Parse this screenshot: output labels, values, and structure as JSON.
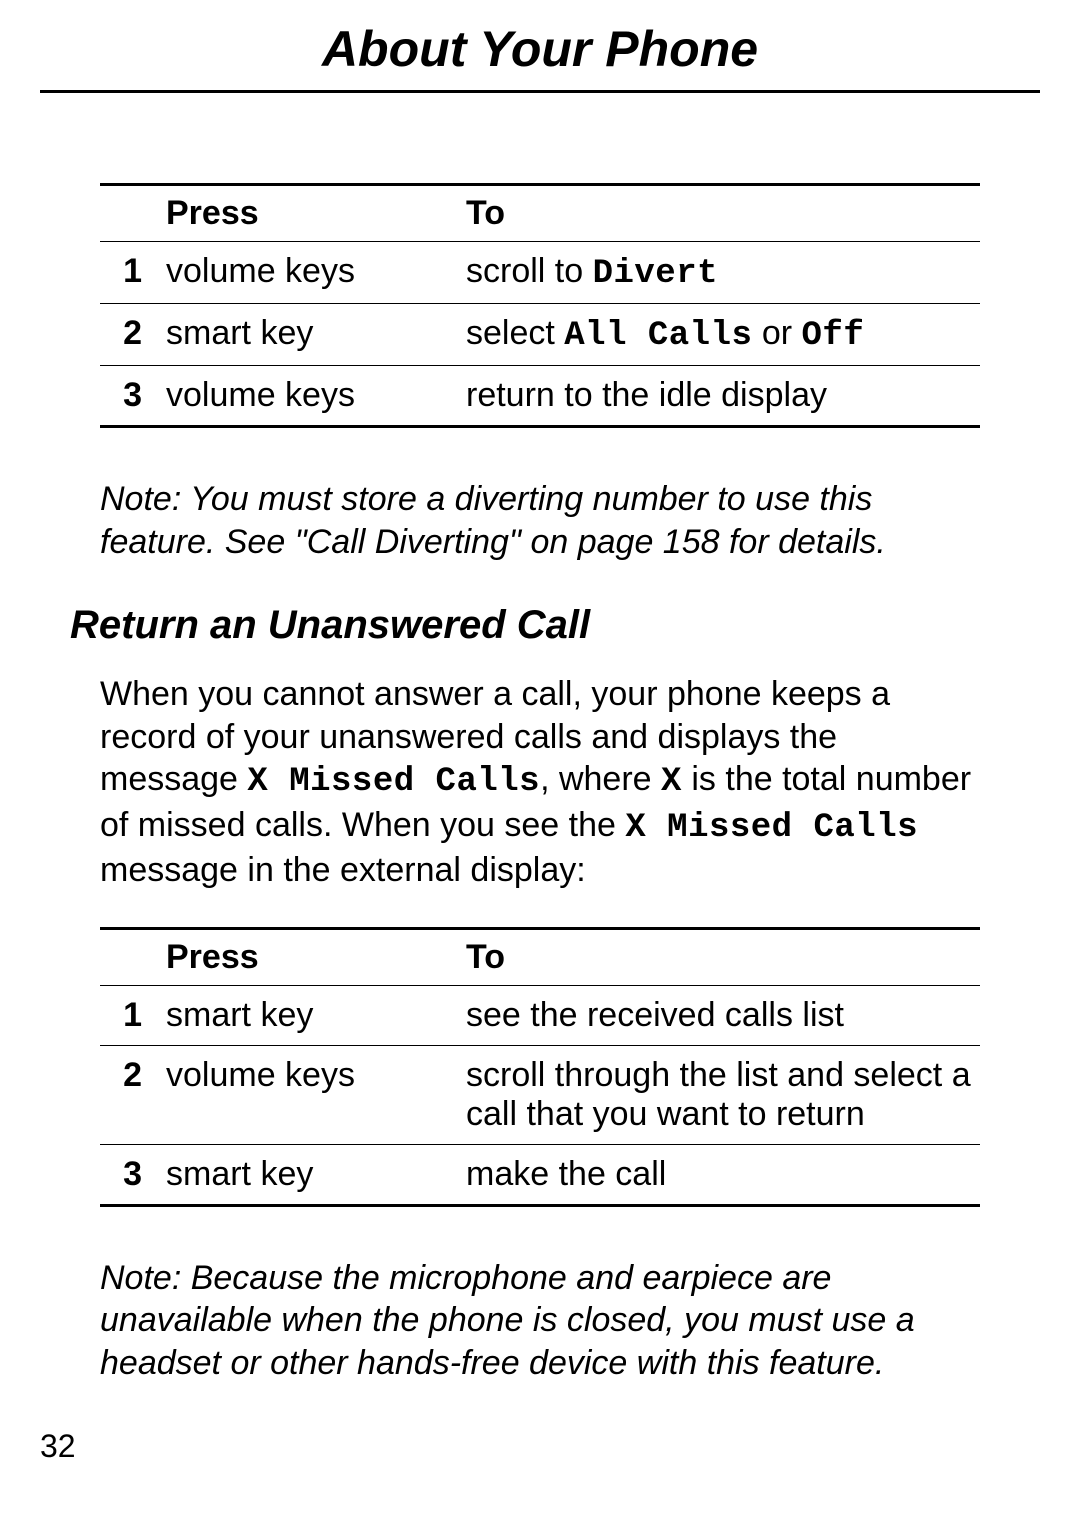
{
  "pageTitle": "About Your Phone",
  "table1": {
    "headers": {
      "press": "Press",
      "to": "To"
    },
    "rows": [
      {
        "num": "1",
        "press": "volume keys",
        "to_pre": "scroll to ",
        "to_mono": "Divert",
        "to_post": ""
      },
      {
        "num": "2",
        "press": "smart key",
        "to_pre": "select ",
        "to_mono": "All Calls",
        "to_mid": " or ",
        "to_mono2": "Off",
        "to_post": ""
      },
      {
        "num": "3",
        "press": "volume keys",
        "to_pre": "return to the idle display",
        "to_mono": "",
        "to_post": ""
      }
    ]
  },
  "note1": "Note: You must store a diverting number to use this feature. See \"Call Diverting\" on page 158 for details.",
  "subheading": "Return an Unanswered Call",
  "para1": {
    "t1": "When you cannot answer a call, your phone keeps a record of your unanswered calls and displays the message ",
    "m1": "X Missed Calls",
    "t2": ", where ",
    "m2": "X",
    "t3": " is the total number of missed calls. When you see the ",
    "m3": "X Missed Calls",
    "t4": " message in the external display:"
  },
  "table2": {
    "headers": {
      "press": "Press",
      "to": "To"
    },
    "rows": [
      {
        "num": "1",
        "press": "smart key",
        "to": "see the received calls list"
      },
      {
        "num": "2",
        "press": "volume keys",
        "to": "scroll through the list and select a call that you want to return"
      },
      {
        "num": "3",
        "press": "smart key",
        "to": "make the call"
      }
    ]
  },
  "note2": "Note: Because the microphone and earpiece are unavailable when the phone is closed, you must use a headset or other hands-free device with this feature.",
  "pageNumber": "32"
}
